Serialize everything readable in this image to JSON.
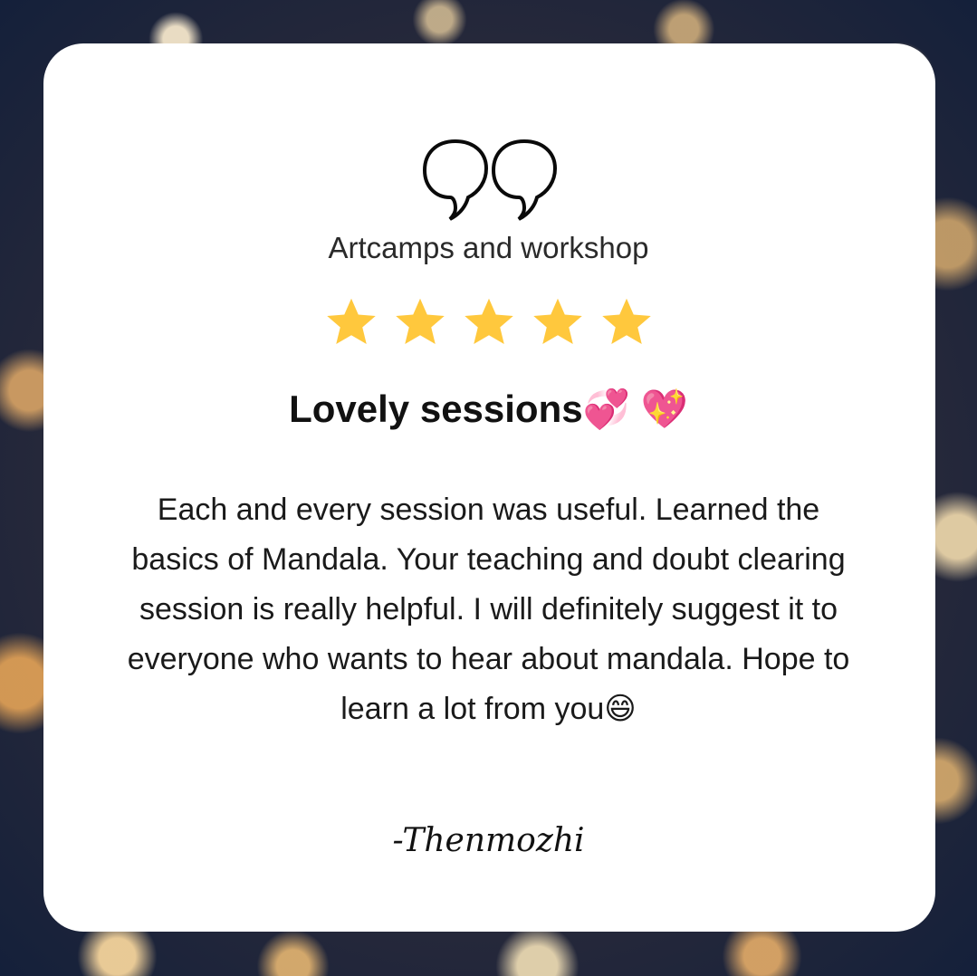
{
  "subtitle": "Artcamps and workshop",
  "rating": {
    "value": 5,
    "max": 5,
    "star_color": "#FFC83D"
  },
  "headline": "Lovely sessions💞 💖",
  "review_text": "Each and every session was useful. Learned the basics of Mandala. Your teaching and doubt clearing session is really helpful. I will definitely suggest it to everyone who wants to hear about mandala. Hope to learn a lot from you😄",
  "signature": "-Thenmozhi",
  "colors": {
    "card": "#FFFFFF",
    "text": "#111111"
  }
}
